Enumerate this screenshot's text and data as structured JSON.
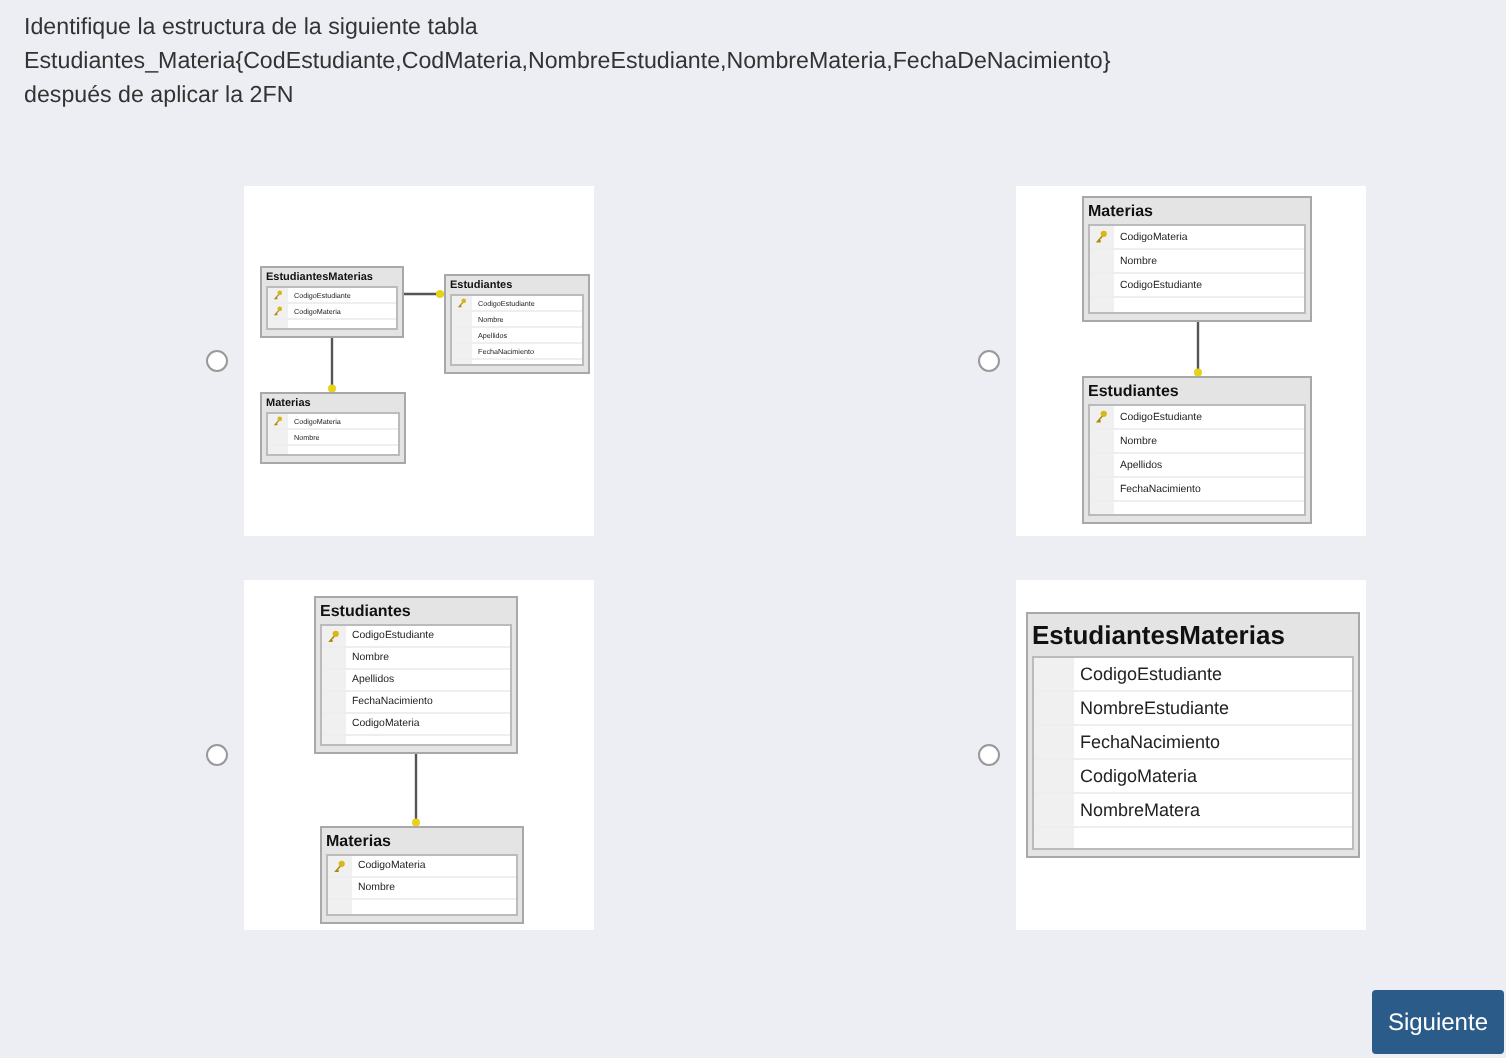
{
  "question": {
    "lines": [
      "Identifique la estructura de la siguiente tabla",
      "Estudiantes_Materia{CodEstudiante,CodMateria,NombreEstudiante,NombreMateria,FechaDeNacimiento}",
      "después de aplicar la 2FN"
    ]
  },
  "options": [
    {
      "selected": false,
      "diagram": {
        "tables": [
          {
            "name": "EstudiantesMaterias",
            "columns": [
              {
                "name": "CodigoEstudiante",
                "key": true
              },
              {
                "name": "CodigoMateria",
                "key": true
              }
            ]
          },
          {
            "name": "Estudiantes",
            "columns": [
              {
                "name": "CodigoEstudiante",
                "key": true
              },
              {
                "name": "Nombre",
                "key": false
              },
              {
                "name": "Apellidos",
                "key": false
              },
              {
                "name": "FechaNacimiento",
                "key": false
              }
            ]
          },
          {
            "name": "Materias",
            "columns": [
              {
                "name": "CodigoMateria",
                "key": true
              },
              {
                "name": "Nombre",
                "key": false
              }
            ]
          }
        ]
      }
    },
    {
      "selected": false,
      "diagram": {
        "tables": [
          {
            "name": "Materias",
            "columns": [
              {
                "name": "CodigoMateria",
                "key": true
              },
              {
                "name": "Nombre",
                "key": false
              },
              {
                "name": "CodigoEstudiante",
                "key": false
              }
            ]
          },
          {
            "name": "Estudiantes",
            "columns": [
              {
                "name": "CodigoEstudiante",
                "key": true
              },
              {
                "name": "Nombre",
                "key": false
              },
              {
                "name": "Apellidos",
                "key": false
              },
              {
                "name": "FechaNacimiento",
                "key": false
              }
            ]
          }
        ]
      }
    },
    {
      "selected": false,
      "diagram": {
        "tables": [
          {
            "name": "Estudiantes",
            "columns": [
              {
                "name": "CodigoEstudiante",
                "key": true
              },
              {
                "name": "Nombre",
                "key": false
              },
              {
                "name": "Apellidos",
                "key": false
              },
              {
                "name": "FechaNacimiento",
                "key": false
              },
              {
                "name": "CodigoMateria",
                "key": false
              }
            ]
          },
          {
            "name": "Materias",
            "columns": [
              {
                "name": "CodigoMateria",
                "key": true
              },
              {
                "name": "Nombre",
                "key": false
              }
            ]
          }
        ]
      }
    },
    {
      "selected": false,
      "diagram": {
        "tables": [
          {
            "name": "EstudiantesMaterias",
            "columns": [
              {
                "name": "CodigoEstudiante",
                "key": false
              },
              {
                "name": "NombreEstudiante",
                "key": false
              },
              {
                "name": "FechaNacimiento",
                "key": false
              },
              {
                "name": "CodigoMateria",
                "key": false
              },
              {
                "name": "NombreMatera",
                "key": false
              }
            ]
          }
        ]
      }
    }
  ],
  "next_button": "Siguiente"
}
